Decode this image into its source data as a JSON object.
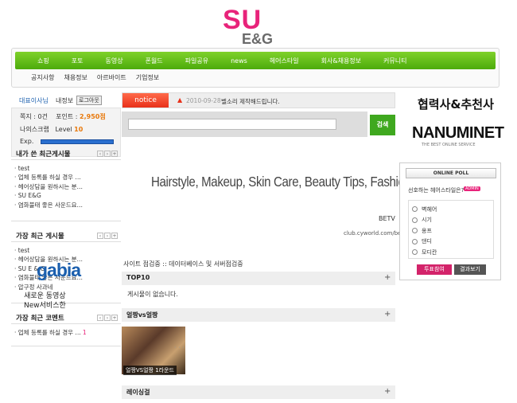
{
  "logo": {
    "line1": "SU",
    "line2": "E&G"
  },
  "nav": {
    "main": [
      "쇼핑",
      "포토",
      "동영상",
      "폰월드",
      "파일공유",
      "news",
      "헤어스타일",
      "회사&채용정보",
      "커뮤니티"
    ],
    "sub": [
      "공지사항",
      "채용정보",
      "아르바이트",
      "기업정보"
    ]
  },
  "login": {
    "user": "대표이사님",
    "menu": "내정보",
    "logout": "로그아웃",
    "notes_label": "쪽지 :",
    "notes_value": "0건",
    "points_label": "포인트 :",
    "points_value": "2,950점",
    "nickname": "나의스크랩",
    "level_label": "Level",
    "level_value": "10",
    "exp_label": "Exp."
  },
  "left": {
    "my_posts": {
      "title": "내가 쓴 최근게시물",
      "items": [
        "test",
        "업체 등록를 하실 경우 …",
        "헤어상담을 원하시는 분…",
        "SU E&G",
        "염화불태 좋은 사운드요…"
      ]
    },
    "recent_posts": {
      "title": "가장 최근 게시물",
      "items": [
        "test",
        "헤어상담을 원하시는 분…",
        "SU E & G",
        "염화불태 좋은 사운드요…",
        "압구정 사과네"
      ]
    },
    "recent_comments": {
      "title": "가장 최근 코멘트",
      "item": "업체 등록를 하실 경우 …",
      "count": "1"
    },
    "gabia": {
      "logo": "gabia",
      "line1": "새로운 동영상",
      "line2": "New서비스한"
    }
  },
  "notice": {
    "tag": "notice",
    "date": "2010-09-28",
    "text": "벨소리 제작해드립니다."
  },
  "search": {
    "button": "검색",
    "placeholder": ""
  },
  "banner": {
    "text": "Hairstyle, Makeup, Skin Care, Beauty Tips, Fashion",
    "brand": "BETV",
    "url": "club.cyworld.com/betv"
  },
  "maintenance": "사이트 점검중 :: 데이터베이스 및 서버점검중",
  "sections": {
    "top10": "TOP10",
    "empty": "게시물이 없습니다.",
    "photo_title": "얼짱vs얼짱",
    "photo_caption": "얼짱VS얼짱 1라운드",
    "photo_more": "· · ·",
    "last": "레이싱걸",
    "plus": "+"
  },
  "right": {
    "partner": "협력사&추천사",
    "nanum": "NANUMINET",
    "nanum_sub": "THE BEST ONLINE SERVICE",
    "poll": {
      "title": "ONLINE POLL",
      "question": "선호하는 헤어스타일은?",
      "admin": "ADMIN",
      "options": [
        "벽헤어",
        "시기",
        "옹프",
        "댄디",
        "모디칸"
      ],
      "vote": "투표참여",
      "result": "결과보기"
    }
  },
  "colors": {
    "nav_green": "#4cab0b",
    "accent_pink": "#e8237a",
    "notice_red": "#e8311a",
    "search_green": "#3fa81f"
  }
}
